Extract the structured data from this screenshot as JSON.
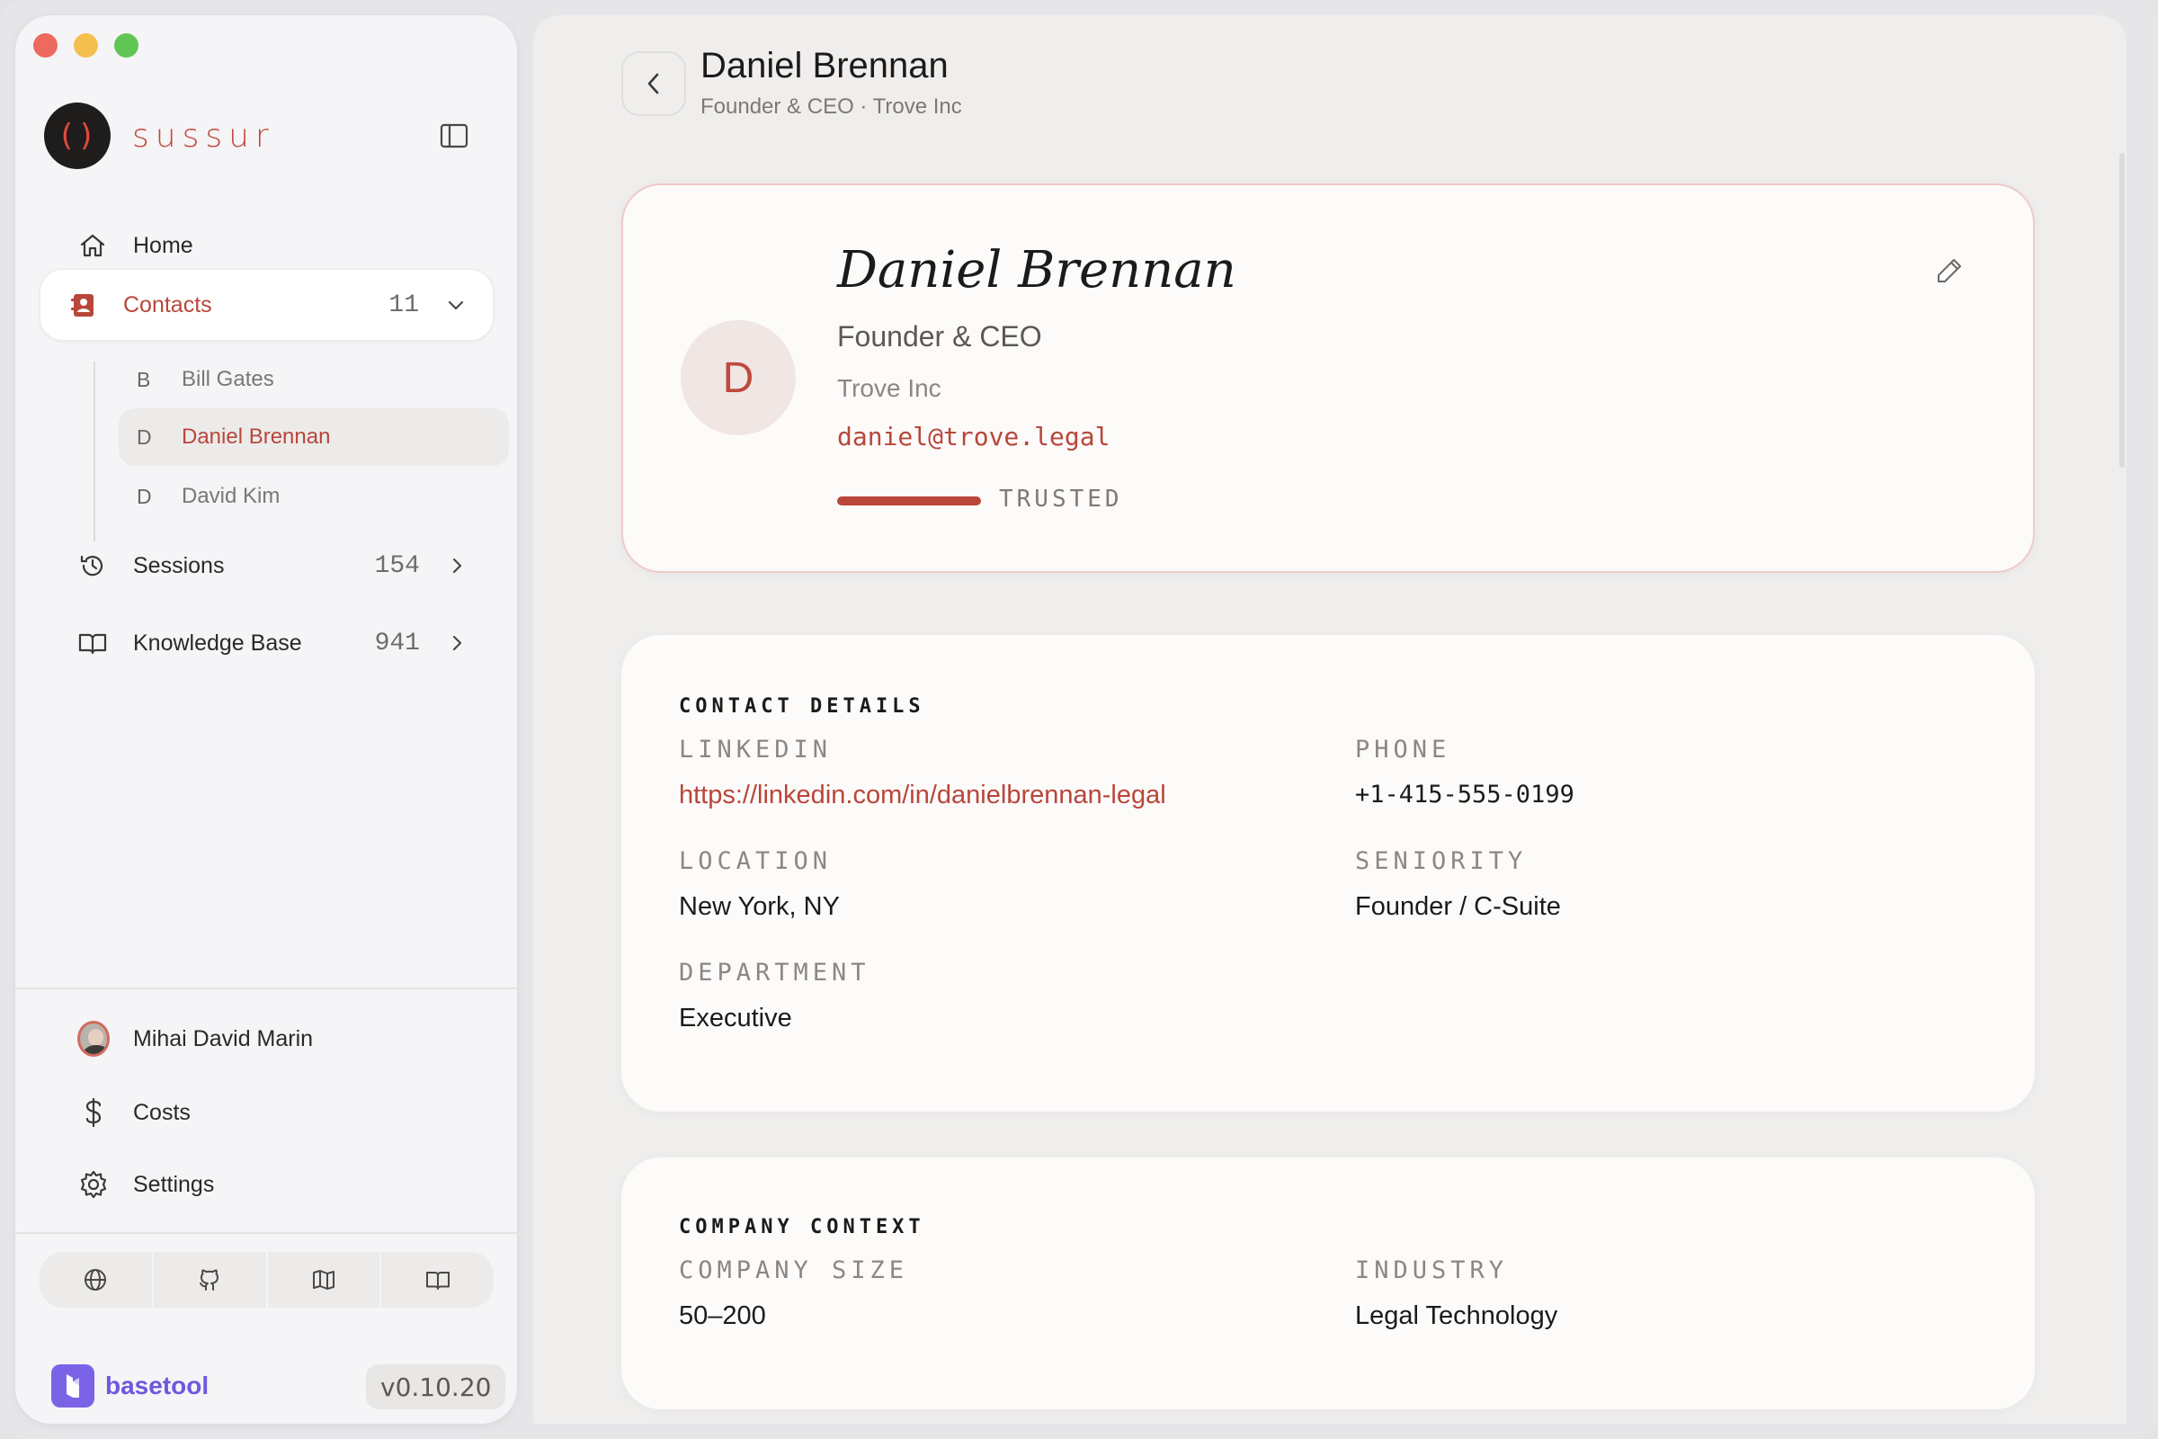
{
  "app": {
    "brand_name": "sussur",
    "brand_mark": "()",
    "accent": "#b9463a"
  },
  "sidebar": {
    "nav": [
      {
        "label": "Home",
        "icon": "home-icon"
      },
      {
        "label": "Contacts",
        "icon": "contacts-icon",
        "count": "11",
        "expanded": true,
        "active": true
      },
      {
        "label": "Sessions",
        "icon": "history-icon",
        "count": "154"
      },
      {
        "label": "Knowledge Base",
        "icon": "book-icon",
        "count": "941"
      }
    ],
    "contacts": [
      {
        "initial": "B",
        "name": "Bill Gates"
      },
      {
        "initial": "D",
        "name": "Daniel Brennan",
        "active": true
      },
      {
        "initial": "D",
        "name": "David Kim"
      }
    ],
    "footer": {
      "user_name": "Mihai David Marin",
      "costs_label": "Costs",
      "settings_label": "Settings"
    },
    "social_icons": [
      "globe-icon",
      "github-icon",
      "map-icon",
      "docs-icon"
    ],
    "vendor": {
      "name": "basetool",
      "version": "v0.10.20"
    }
  },
  "header": {
    "title": "Daniel Brennan",
    "subtitle": "Founder & CEO · Trove Inc"
  },
  "profile": {
    "initial": "D",
    "name": "Daniel Brennan",
    "title": "Founder & CEO",
    "company": "Trove Inc",
    "email": "daniel@trove.legal",
    "trust_label": "TRUSTED",
    "trust_level": 1.0
  },
  "contact_details": {
    "section_title": "CONTACT DETAILS",
    "linkedin_label": "LINKEDIN",
    "linkedin_value": "https://linkedin.com/in/danielbrennan-legal",
    "phone_label": "PHONE",
    "phone_value": "+1-415-555-0199",
    "location_label": "LOCATION",
    "location_value": "New York, NY",
    "seniority_label": "SENIORITY",
    "seniority_value": "Founder / C-Suite",
    "department_label": "DEPARTMENT",
    "department_value": "Executive"
  },
  "company_context": {
    "section_title": "COMPANY CONTEXT",
    "size_label": "COMPANY SIZE",
    "size_value": "50–200",
    "industry_label": "INDUSTRY",
    "industry_value": "Legal Technology"
  }
}
